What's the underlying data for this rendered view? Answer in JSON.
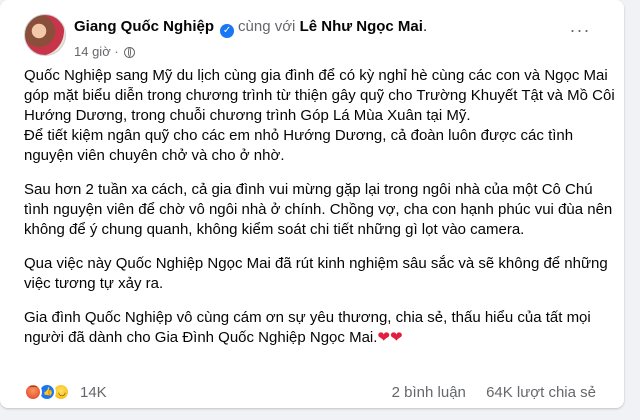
{
  "post": {
    "author": "Giang Quốc Nghiệp",
    "with_text": "cùng với",
    "tagged": "Lê Như Ngọc Mai",
    "trailing": ".",
    "time": "14 giờ",
    "dot": "·",
    "more_label": "···",
    "verified_glyph": "✓",
    "paragraphs": [
      "Quốc Nghiệp sang Mỹ du lịch cùng gia đình để có kỳ nghỉ hè cùng các con và Ngọc Mai góp mặt biểu diễn trong chương trình từ thiện gây quỹ cho Trường Khuyết Tật và Mồ Côi Hướng Dương, trong chuỗi chương trình Góp Lá Mùa Xuân tại Mỹ.\n Để tiết kiệm ngân quỹ cho các em nhỏ Hướng Dương, cả đoàn luôn được các tình nguyện viên chuyên chở và cho ở nhờ.",
      "Sau hơn 2 tuần xa cách, cả gia đình vui mừng gặp lại trong ngôi nhà của một Cô Chú tình nguyện viên để chờ vô ngôi nhà ở chính. Chồng vợ, cha con hạnh phúc vui đùa nên không để ý chung quanh, không kiểm soát chi tiết những gì lọt vào camera.",
      "Qua việc này Quốc Nghiệp Ngọc Mai đã rút kinh nghiệm sâu sắc và sẽ không để những việc tương tự xảy ra."
    ],
    "closing": " Gia đình Quốc Nghiệp vô cùng cám ơn sự yêu thương, chia sẻ, thấu hiểu của tất mọi người đã dành cho Gia Đình Quốc Nghiệp Ngọc Mai.",
    "hearts": "❤❤"
  },
  "footer": {
    "reaction_count": "14K",
    "comments": "2 bình luận",
    "shares": "64K lượt chia sẻ",
    "reaction_icons": [
      "angry-icon",
      "like-icon",
      "haha-icon"
    ]
  }
}
